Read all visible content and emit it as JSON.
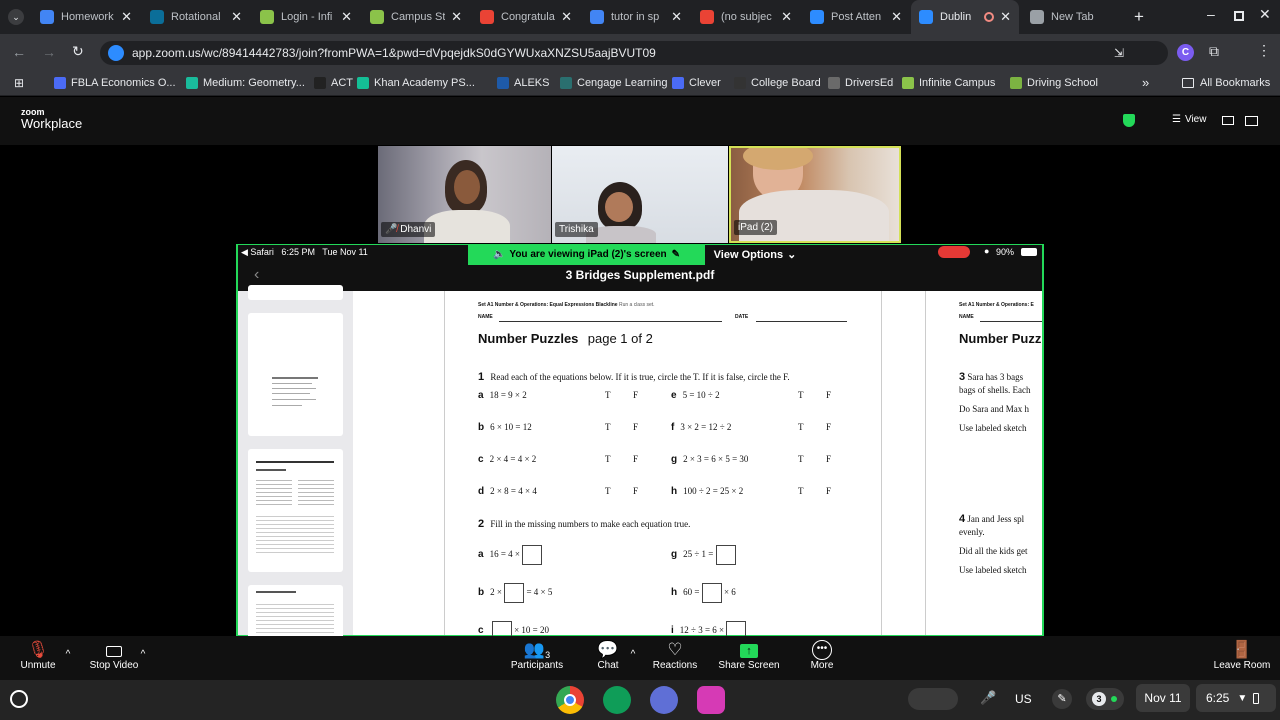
{
  "browser": {
    "tabs": [
      {
        "title": "Homework",
        "icon": "docs",
        "color": "#4285f4"
      },
      {
        "title": "Rotational",
        "icon": "pearson",
        "color": "#0b6e99"
      },
      {
        "title": "Login - Infi",
        "icon": "infinite-campus",
        "color": "#8bc34a"
      },
      {
        "title": "Campus St",
        "icon": "campus",
        "color": "#8bc34a"
      },
      {
        "title": "Congratula",
        "icon": "gmail",
        "color": "#ea4335"
      },
      {
        "title": "tutor in sp",
        "icon": "google",
        "color": "#4285f4"
      },
      {
        "title": "(no subjec",
        "icon": "gmail",
        "color": "#ea4335"
      },
      {
        "title": "Post Atten",
        "icon": "zoom",
        "color": "#2d8cff"
      },
      {
        "title": "Dublin",
        "icon": "zoom",
        "color": "#2d8cff"
      },
      {
        "title": "New Tab",
        "icon": "chrome",
        "color": "#9aa0a6"
      }
    ],
    "url": "app.zoom.us/wc/89414442783/join?fromPWA=1&pwd=dVpqejdkS0dGYWUxaXNZSU5aajBVUT09",
    "bookmarks": [
      "FBLA Economics O...",
      "Medium: Geometry...",
      "ACT",
      "Khan Academy PS...",
      "ALEKS",
      "Cengage Learning",
      "Clever",
      "College Board",
      "DriversEd",
      "Infinite Campus",
      "Driving School"
    ],
    "all_bookmarks": "All Bookmarks"
  },
  "zoom": {
    "logo_top": "zoom",
    "logo_bottom": "Workplace",
    "view_label": "View",
    "participants": [
      {
        "name": "Dhanvi",
        "muted": true
      },
      {
        "name": "Trishika",
        "muted": false
      },
      {
        "name": "iPad (2)",
        "muted": false
      }
    ],
    "viewing_banner": "You are viewing  iPad (2)'s screen",
    "view_options": "View Options",
    "controls": {
      "unmute": "Unmute",
      "stop_video": "Stop Video",
      "participants": "Participants",
      "participants_count": "3",
      "chat": "Chat",
      "reactions": "Reactions",
      "share_screen": "Share Screen",
      "more": "More",
      "leave": "Leave Room"
    }
  },
  "ipad": {
    "status_left": "◀ Safari   6:25 PM   Tue Nov 11",
    "battery": "90%",
    "pdf_title": "3 Bridges Supplement.pdf"
  },
  "pdf": {
    "header": "Set A1 Number & Operations: Equal Expressions Blackline",
    "header_note": "Run a class set.",
    "name_label": "NAME",
    "date_label": "DATE",
    "title": "Number Puzzles",
    "subtitle": "page 1 of 2",
    "q1_num": "1",
    "q1_text": "Read each of the equations below. If it is true, circle the T. If it is false, circle the F.",
    "q1_items": [
      {
        "letter": "a",
        "eq": "18 = 9 × 2"
      },
      {
        "letter": "e",
        "eq": "5 = 10 ÷ 2"
      },
      {
        "letter": "b",
        "eq": "6 × 10 = 12"
      },
      {
        "letter": "f",
        "eq": "3 × 2 = 12 ÷ 2"
      },
      {
        "letter": "c",
        "eq": "2 × 4 = 4 × 2"
      },
      {
        "letter": "g",
        "eq": "2 × 3 = 6 × 5 = 30"
      },
      {
        "letter": "d",
        "eq": "2 × 8 = 4 × 4"
      },
      {
        "letter": "h",
        "eq": "100 ÷ 2 = 25 × 2"
      }
    ],
    "tf_t": "T",
    "tf_f": "F",
    "q2_num": "2",
    "q2_text": "Fill in the missing numbers to make each equation true.",
    "q2_items": [
      {
        "letter": "a",
        "before": "16 = 4 ×",
        "after": ""
      },
      {
        "letter": "g",
        "before": "25 ÷ 1 =",
        "after": ""
      },
      {
        "letter": "b",
        "before": "2 ×",
        "after": "= 4 × 5"
      },
      {
        "letter": "h",
        "before": "60 =",
        "after": "× 6"
      }
    ],
    "q2_cut": [
      {
        "letter": "c",
        "before": "",
        "after": "× 10 = 20"
      },
      {
        "letter": "i",
        "before": "12 ÷ 3 = 6 ×",
        "after": ""
      }
    ],
    "right_header": "Set A1 Number & Operations: E",
    "right_name": "NAME",
    "right_title": "Number Puzz",
    "q3_num": "3",
    "q3_lines": [
      "Sara has 3 bags",
      "bags of shells. Each",
      "Do Sara and Max h",
      "Use labeled sketch"
    ],
    "q4_num": "4",
    "q4_lines": [
      "Jan and Jess spl",
      "evenly.",
      "Did all the kids get",
      "Use labeled sketch"
    ]
  },
  "shelf": {
    "lang": "US",
    "notif_count": "3",
    "date": "Nov 11",
    "time": "6:25"
  }
}
